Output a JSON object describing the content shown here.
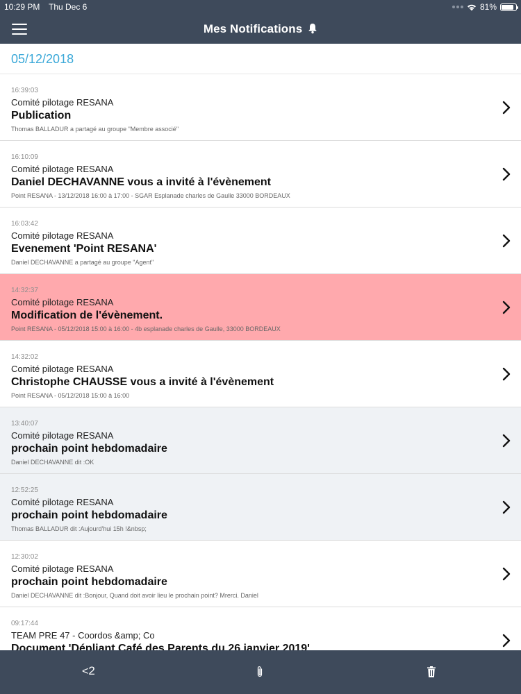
{
  "status_bar": {
    "time": "10:29 PM",
    "date": "Thu Dec 6",
    "battery": "81%"
  },
  "nav": {
    "title": "Mes Notifications",
    "bell_icon": "bell-icon",
    "menu_icon": "hamburger-menu-icon"
  },
  "date_header": "05/12/2018",
  "colors": {
    "nav_bg": "#3e4a5b",
    "accent": "#3aa8d8",
    "highlight_red": "#ffa9ad",
    "highlight_gray": "#eff2f5"
  },
  "notifications": [
    {
      "time": "16:39:03",
      "group": "Comité pilotage RESANA",
      "title": "Publication",
      "detail": "Thomas BALLADUR a partagé au groupe \"Membre associé\"",
      "state": "normal"
    },
    {
      "time": "16:10:09",
      "group": "Comité pilotage RESANA",
      "title": "Daniel DECHAVANNE vous a invité à l'évènement",
      "detail": "Point RESANA - 13/12/2018 16:00 à 17:00 - SGAR Esplanade charles de Gaulle 33000 BORDEAUX",
      "state": "normal"
    },
    {
      "time": "16:03:42",
      "group": "Comité pilotage RESANA",
      "title": "Evenement 'Point RESANA'",
      "detail": "Daniel DECHAVANNE a partagé au groupe \"Agent\"",
      "state": "normal"
    },
    {
      "time": "14:32:37",
      "group": "Comité pilotage RESANA",
      "title": "Modification de l'évènement.",
      "detail": "Point RESANA - 05/12/2018 15:00 à 16:00 - 4b esplanade charles de Gaulle, 33000 BORDEAUX",
      "state": "alert"
    },
    {
      "time": "14:32:02",
      "group": "Comité pilotage RESANA",
      "title": "Christophe CHAUSSE vous a invité à l'évènement",
      "detail": "Point RESANA - 05/12/2018 15:00 à 16:00",
      "state": "normal"
    },
    {
      "time": "13:40:07",
      "group": "Comité pilotage RESANA",
      "title": "prochain point hebdomadaire",
      "detail": "Daniel DECHAVANNE dit :OK",
      "state": "read"
    },
    {
      "time": "12:52:25",
      "group": "Comité pilotage RESANA",
      "title": "prochain point hebdomadaire",
      "detail": "Thomas BALLADUR dit :Aujourd'hui 15h !&nbsp;",
      "state": "read"
    },
    {
      "time": "12:30:02",
      "group": "Comité pilotage RESANA",
      "title": "prochain point hebdomadaire",
      "detail": "Daniel DECHAVANNE dit :Bonjour, Quand doit avoir lieu le prochain point? Mrerci. Daniel",
      "state": "normal"
    },
    {
      "time": "09:17:44",
      "group": "TEAM PRE 47 - Coordos &amp; Co",
      "title": "Document 'Dépliant Café des Parents du 26 janvier 2019'",
      "detail": "",
      "state": "normal"
    }
  ],
  "tab_bar": {
    "back_label": "2",
    "attachment_icon": "paperclip-icon",
    "trash_icon": "trash-icon"
  }
}
